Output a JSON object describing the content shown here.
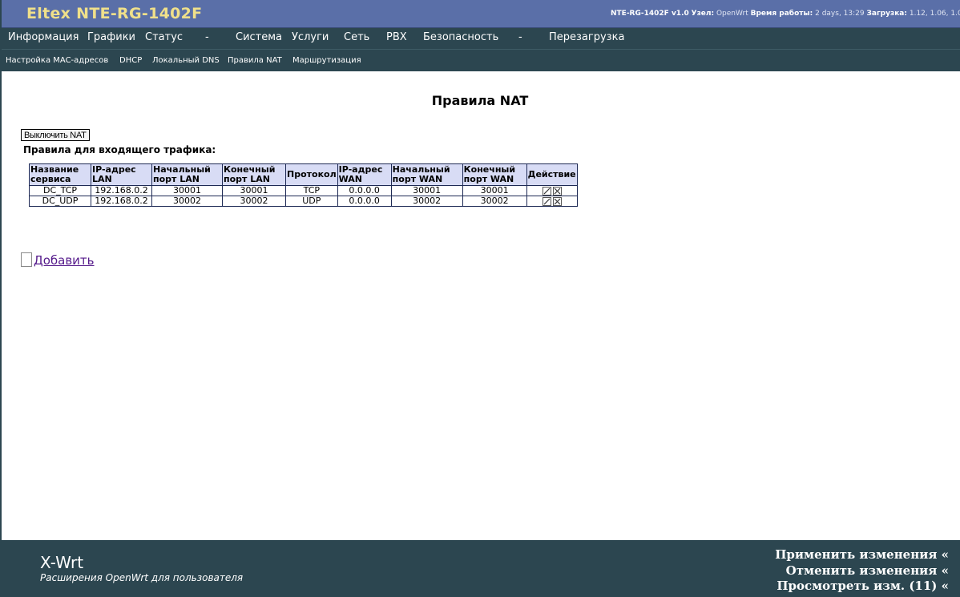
{
  "header": {
    "brand": "Eltex NTE-RG-1402F",
    "model_label": "NTE-RG-1402F v1.0",
    "node_label": "Узел:",
    "node_value": "OpenWrt",
    "uptime_label": "Время работы:",
    "uptime_value": "2 days, 13:29",
    "load_label": "Загрузка:",
    "load_value": "1.12, 1.06, 1.0"
  },
  "menu": {
    "items": [
      "Информация",
      "Графики",
      "Статус",
      "-",
      "Система",
      "Услуги",
      "Сеть",
      "PBX",
      "Безопасность",
      "-",
      "Перезагрузка"
    ]
  },
  "submenu": {
    "items": [
      "Настройка MAC-адресов",
      "DHCP",
      "Локальный DNS",
      "Правила NAT",
      "Маршрутизация"
    ]
  },
  "main": {
    "title": "Правила NAT",
    "disable_nat_button": "Выключить NAT",
    "section_title": "Правила для входящего трафика:",
    "add_link": "Добавить"
  },
  "table": {
    "headers": [
      "Название сервиса",
      "IP-адрес LAN",
      "Начальный порт LAN",
      "Конечный порт LAN",
      "Протокол",
      "IP-адрес WAN",
      "Начальный порт WAN",
      "Конечный порт WAN",
      "Действие"
    ],
    "rows": [
      [
        "DC_TCP",
        "192.168.0.2",
        "30001",
        "30001",
        "TCP",
        "0.0.0.0",
        "30001",
        "30001"
      ],
      [
        "DC_UDP",
        "192.168.0.2",
        "30002",
        "30002",
        "UDP",
        "0.0.0.0",
        "30002",
        "30002"
      ]
    ],
    "action_icons": [
      "edit-icon",
      "delete-icon"
    ]
  },
  "footer": {
    "product": "X-Wrt",
    "tagline": "Расширения OpenWrt для пользователя",
    "apply": "Применить изменения «",
    "cancel": "Отменить изменения «",
    "review": "Просмотреть изм. (11) «"
  }
}
